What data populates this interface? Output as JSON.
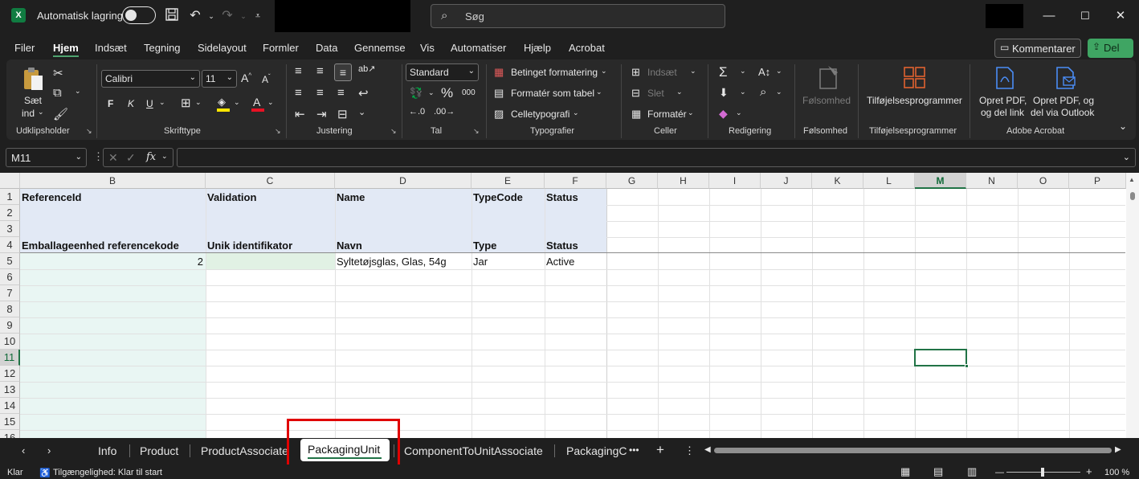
{
  "titlebar": {
    "app_icon": "excel-icon",
    "autosave_label": "Automatisk lagring",
    "autosave_state": "off",
    "search_placeholder": "Søg",
    "icons": [
      "save-icon",
      "undo-icon",
      "redo-icon",
      "customize-qat-icon"
    ],
    "window_buttons": [
      "minimize-icon",
      "maximize-icon",
      "close-icon"
    ]
  },
  "menu": {
    "items": [
      "Filer",
      "Hjem",
      "Indsæt",
      "Tegning",
      "Sidelayout",
      "Formler",
      "Data",
      "Gennemse",
      "Vis",
      "Automatiser",
      "Hjælp",
      "Acrobat"
    ],
    "active": "Hjem",
    "comment_label": "Kommentarer",
    "share_label": "Del"
  },
  "ribbon": {
    "clipboard": {
      "paste": "Sæt",
      "paste2": "ind",
      "label": "Udklipsholder"
    },
    "font": {
      "name": "Calibri",
      "size": "11",
      "bold": "F",
      "italic": "K",
      "underline": "U",
      "label": "Skrifttype"
    },
    "alignment": {
      "label": "Justering"
    },
    "number": {
      "format": "Standard",
      "percent": "%",
      "thousands": "000",
      "label": "Tal"
    },
    "styles": {
      "conditional": "Betinget formatering",
      "as_table": "Formatér som tabel",
      "cell_styles": "Celletypografi",
      "label": "Typografier"
    },
    "cells": {
      "insert": "Indsæt",
      "delete": "Slet",
      "format": "Formatér",
      "label": "Celler"
    },
    "editing": {
      "label": "Redigering"
    },
    "sensitivity": {
      "btn": "Følsomhed",
      "label": "Følsomhed"
    },
    "addins": {
      "btn": "Tilføjelsesprogrammer",
      "label": "Tilføjelsesprogrammer"
    },
    "acrobat": {
      "btn1_l1": "Opret PDF,",
      "btn1_l2": "og del link",
      "btn2_l1": "Opret PDF, og",
      "btn2_l2": "del via Outlook",
      "label": "Adobe Acrobat"
    }
  },
  "formula_bar": {
    "name_box": "M11",
    "formula": "",
    "fx": "fx"
  },
  "columns": [
    "B",
    "C",
    "D",
    "E",
    "F",
    "G",
    "H",
    "I",
    "J",
    "K",
    "L",
    "M",
    "N",
    "O",
    "P"
  ],
  "selected_column": "M",
  "rows": [
    "1",
    "2",
    "3",
    "4",
    "5",
    "6",
    "7",
    "8",
    "9",
    "10",
    "11",
    "12",
    "13",
    "14",
    "15",
    "16"
  ],
  "selected_row": "11",
  "cells": {
    "B1": "ReferenceId",
    "C1": "Validation",
    "D1": "Name",
    "E1": "TypeCode",
    "F1": "Status",
    "B4": "Emballageenhed referencekode",
    "C4": "Unik identifikator",
    "D4": "Navn",
    "E4": "Type",
    "F4": "Status",
    "B5": "2",
    "D5": "Syltetøjsglas, Glas, 54g",
    "E5": "Jar",
    "F5": "Active"
  },
  "sheet_tabs": {
    "items": [
      "Info",
      "Product",
      "ProductAssociate",
      "PackagingUnit",
      "ComponentToUnitAssociate",
      "PackagingC"
    ],
    "active": "PackagingUnit",
    "more": "•••",
    "add": "+"
  },
  "statusbar": {
    "mode": "Klar",
    "accessibility": "Tilgængelighed: Klar til start",
    "zoom": "100 %"
  },
  "colors": {
    "accent": "#217346",
    "highlight_box": "#e00000",
    "header_fill": "#e2e9f5"
  }
}
